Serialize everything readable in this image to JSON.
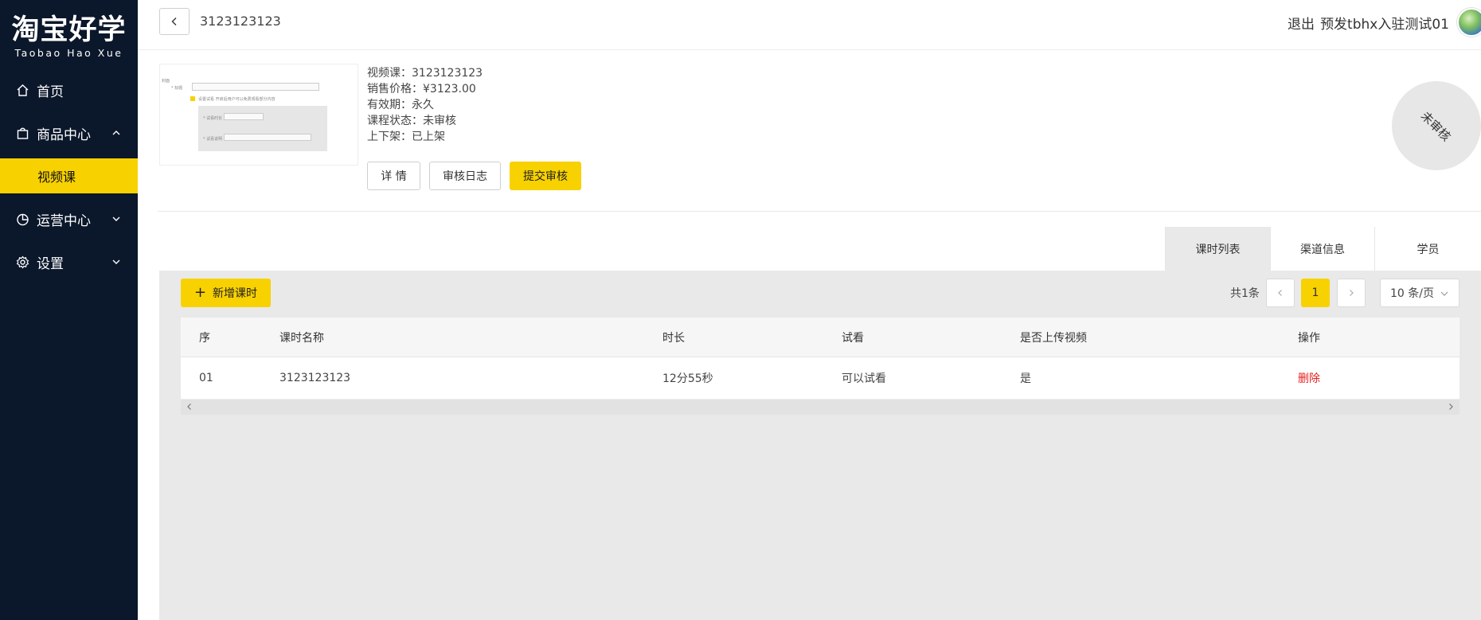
{
  "brand": {
    "name_cn": "淘宝好学",
    "name_en": "Taobao Hao Xue"
  },
  "sidebar": {
    "items": [
      {
        "label": "首页",
        "icon": "home-icon"
      },
      {
        "label": "商品中心",
        "icon": "bag-icon",
        "expanded": true,
        "children": [
          {
            "label": "视频课",
            "active": true
          }
        ]
      },
      {
        "label": "运营中心",
        "icon": "pie-chart-icon"
      },
      {
        "label": "设置",
        "icon": "gear-icon"
      }
    ]
  },
  "header": {
    "title": "3123123123",
    "logout": "退出",
    "username": "预发tbhx入驻测试01"
  },
  "course": {
    "name_line": "视频课：3123123123",
    "price_line": "销售价格：¥3123.00",
    "validity_line": "有效期：永久",
    "status_line": "课程状态：未审核",
    "shelf_line": "上下架：已上架",
    "badge": "未审核",
    "buttons": {
      "detail": "详 情",
      "audit_log": "审核日志",
      "submit": "提交审核"
    }
  },
  "tabs": [
    {
      "label": "课时列表",
      "active": true
    },
    {
      "label": "渠道信息",
      "active": false
    },
    {
      "label": "学员",
      "active": false
    }
  ],
  "toolbar": {
    "add_label": "新增课时"
  },
  "pagination": {
    "total": "共1条",
    "current_page": "1",
    "page_size": "10 条/页"
  },
  "table": {
    "columns": [
      "序",
      "课时名称",
      "时长",
      "试看",
      "是否上传视频",
      "操作"
    ],
    "rows": [
      {
        "index": "01",
        "name": "3123123123",
        "duration": "12分55秒",
        "preview": "可以试看",
        "uploaded": "是",
        "action": "删除"
      }
    ]
  },
  "colors": {
    "sidebar_bg": "#0b172b",
    "accent": "#f8d100",
    "danger": "#e6201c"
  }
}
